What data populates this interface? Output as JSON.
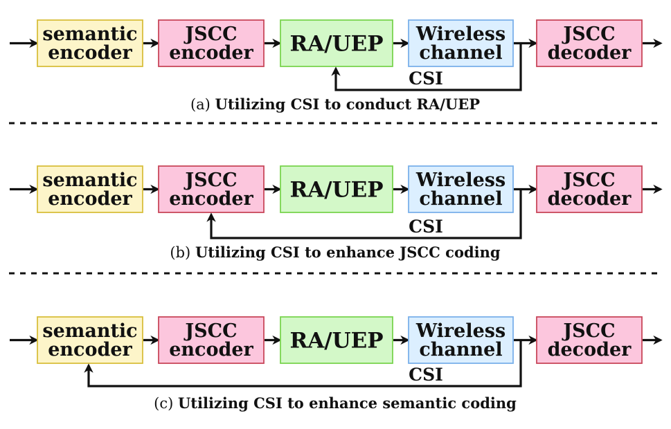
{
  "figure": {
    "block_styles": {
      "semantic": {
        "fill": "#fdf5c9",
        "stroke": "#d9bf3c"
      },
      "jscc": {
        "fill": "#fcc6dd",
        "stroke": "#c8475a"
      },
      "ra": {
        "fill": "#d3f8c8",
        "stroke": "#7ad44f"
      },
      "wireless": {
        "fill": "#dcefff",
        "stroke": "#7ab0ea"
      }
    },
    "arrow_color": "#111111",
    "divider_color": "#111111",
    "panels": [
      {
        "id": "a",
        "blocks": [
          {
            "key": "semantic",
            "lines": [
              "semantic",
              "encoder"
            ]
          },
          {
            "key": "jscc",
            "lines": [
              "JSCC",
              "encoder"
            ]
          },
          {
            "key": "ra",
            "lines": [
              "RA/UEP"
            ]
          },
          {
            "key": "wireless",
            "lines": [
              "Wireless",
              "channel"
            ]
          },
          {
            "key": "jscc",
            "lines": [
              "JSCC",
              "decoder"
            ]
          }
        ],
        "feedback_label": "CSI",
        "feedback_target_block": 2,
        "caption_label": "(a)",
        "caption_text": "Utilizing CSI to conduct RA/UEP"
      },
      {
        "id": "b",
        "blocks": [
          {
            "key": "semantic",
            "lines": [
              "semantic",
              "encoder"
            ]
          },
          {
            "key": "jscc",
            "lines": [
              "JSCC",
              "encoder"
            ]
          },
          {
            "key": "ra",
            "lines": [
              "RA/UEP"
            ]
          },
          {
            "key": "wireless",
            "lines": [
              "Wireless",
              "channel"
            ]
          },
          {
            "key": "jscc",
            "lines": [
              "JSCC",
              "decoder"
            ]
          }
        ],
        "feedback_label": "CSI",
        "feedback_target_block": 1,
        "caption_label": "(b)",
        "caption_text": "Utilizing CSI to enhance JSCC coding"
      },
      {
        "id": "c",
        "blocks": [
          {
            "key": "semantic",
            "lines": [
              "semantic",
              "encoder"
            ]
          },
          {
            "key": "jscc",
            "lines": [
              "JSCC",
              "encoder"
            ]
          },
          {
            "key": "ra",
            "lines": [
              "RA/UEP"
            ]
          },
          {
            "key": "wireless",
            "lines": [
              "Wireless",
              "channel"
            ]
          },
          {
            "key": "jscc",
            "lines": [
              "JSCC",
              "decoder"
            ]
          }
        ],
        "feedback_label": "CSI",
        "feedback_target_block": 0,
        "caption_label": "(c)",
        "caption_text": "Utilizing CSI to enhance semantic coding"
      }
    ]
  }
}
